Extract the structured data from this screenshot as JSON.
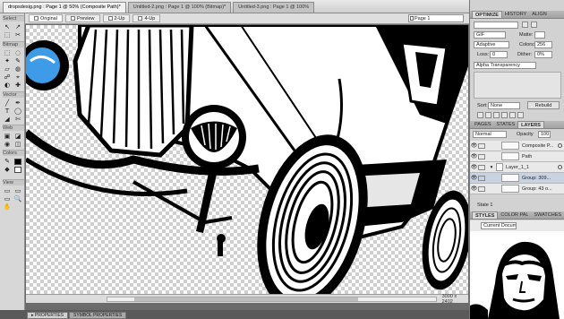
{
  "doc_tabs": [
    {
      "label": "dropsdesig.png : Page 1 @ 50% (Composite Path)*",
      "active": true
    },
    {
      "label": "Untitled-2.png : Page 1 @ 100% (Bitmap)*",
      "active": false
    },
    {
      "label": "Untitled-3.png : Page 1 @ 100%",
      "active": false
    }
  ],
  "view_buttons": [
    {
      "label": "Original",
      "active": true
    },
    {
      "label": "Preview",
      "active": false
    },
    {
      "label": "2-Up",
      "active": false
    },
    {
      "label": "4-Up",
      "active": false
    }
  ],
  "page_selector": "Page 1",
  "tools": {
    "sections": [
      "Select",
      "Bitmap",
      "Vector",
      "Web",
      "Colors",
      "View"
    ],
    "select_tools": [
      "↖",
      "↗",
      "⬚",
      "✂"
    ],
    "bitmap_tools": [
      "⬚",
      "◌",
      "✦",
      "✎",
      "▱",
      "◍",
      "☍",
      "⌖",
      "◐",
      "✚"
    ],
    "vector_tools": [
      "╱",
      "✒",
      "T",
      "◯",
      "◢",
      "✄"
    ],
    "web_tools": [
      "▣",
      "◪",
      "◉",
      "◫"
    ],
    "color_tools": [
      "✎",
      "◆"
    ],
    "view_tools": [
      "▭",
      "▭",
      "▭",
      "🔍",
      "✋"
    ],
    "colors": {
      "stroke": "#000000",
      "fill": "#ffffff"
    }
  },
  "status": {
    "doc_size": "3000 x 2402"
  },
  "prop_tabs": [
    {
      "label": "▸ PROPERTIES",
      "active": true
    },
    {
      "label": "SYMBOL PROPERTIES",
      "active": false
    }
  ],
  "panels": {
    "optimize_tabs": [
      "OPTIMIZE",
      "HISTORY",
      "ALIGN"
    ],
    "optimize": {
      "format": "GIF",
      "matte_label": "Matte:",
      "palette": "Adaptive",
      "colors_label": "Colors:",
      "colors_value": "256",
      "loss_label": "Loss:",
      "loss_value": "0",
      "dither_label": "Dither:",
      "dither_value": "0%",
      "transparency": "Alpha Transparency",
      "sort_label": "Sort:",
      "sort_value": "None",
      "rebuild_label": "Rebuild"
    },
    "layers_tabs": [
      "PAGES",
      "STATES",
      "LAYERS"
    ],
    "layers_toolbar": {
      "blend": "Normal",
      "opacity_label": "Opacity",
      "opacity_value": "100"
    },
    "layers": [
      {
        "name": "Composite P...",
        "selected": false
      },
      {
        "name": "Path",
        "selected": false
      },
      {
        "name": "Layer_1_1",
        "selected": false
      },
      {
        "name": "Group: 309...",
        "selected": true
      },
      {
        "name": "Group: 43 o...",
        "selected": false
      }
    ],
    "state_label": "State 1",
    "styles_tabs": [
      "STYLES",
      "COLOR PAL",
      "SWATCHES"
    ],
    "styles_select": "Current Document"
  },
  "colors": {
    "accent_selection": "#c7d3e3",
    "headlight_blue": "#3d9be8"
  }
}
